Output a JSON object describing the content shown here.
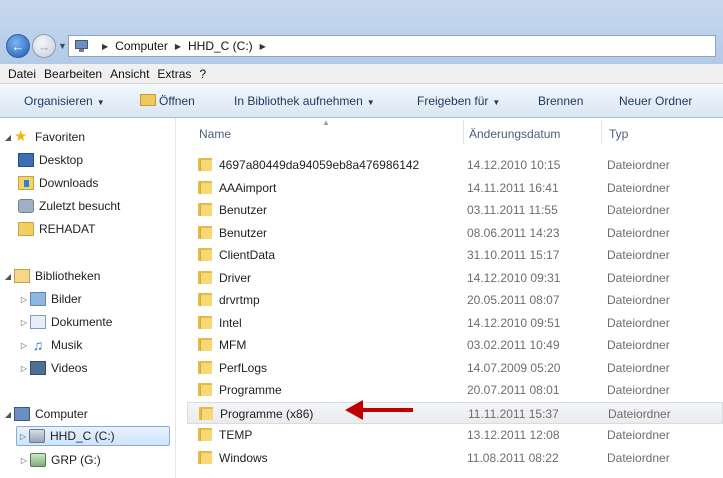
{
  "address": {
    "crumbs": [
      "Computer",
      "HHD_C (C:)"
    ]
  },
  "menu": [
    "Datei",
    "Bearbeiten",
    "Ansicht",
    "Extras",
    "?"
  ],
  "commands": {
    "organize": "Organisieren",
    "open": "Öffnen",
    "library": "In Bibliothek aufnehmen",
    "share": "Freigeben für",
    "burn": "Brennen",
    "new_folder": "Neuer Ordner"
  },
  "nav": {
    "favorites": "Favoriten",
    "desktop": "Desktop",
    "downloads": "Downloads",
    "recent": "Zuletzt besucht",
    "rehadat": "REHADAT",
    "libraries": "Bibliotheken",
    "pictures": "Bilder",
    "documents": "Dokumente",
    "music": "Musik",
    "videos": "Videos",
    "computer": "Computer",
    "drive_c": "HHD_C (C:)",
    "drive_g": "GRP (G:)"
  },
  "columns": {
    "name": "Name",
    "date": "Änderungsdatum",
    "type": "Typ"
  },
  "files": [
    {
      "name": "4697a80449da94059eb8a476986142",
      "date": "14.12.2010 10:15",
      "type": "Dateiordner"
    },
    {
      "name": "AAAimport",
      "date": "14.11.2011 16:41",
      "type": "Dateiordner"
    },
    {
      "name": "Benutzer",
      "date": "03.11.2011 11:55",
      "type": "Dateiordner"
    },
    {
      "name": "Benutzer",
      "date": "08.06.2011 14:23",
      "type": "Dateiordner"
    },
    {
      "name": "ClientData",
      "date": "31.10.2011 15:17",
      "type": "Dateiordner"
    },
    {
      "name": "Driver",
      "date": "14.12.2010 09:31",
      "type": "Dateiordner"
    },
    {
      "name": "drvrtmp",
      "date": "20.05.2011 08:07",
      "type": "Dateiordner"
    },
    {
      "name": "Intel",
      "date": "14.12.2010 09:51",
      "type": "Dateiordner"
    },
    {
      "name": "MFM",
      "date": "03.02.2011 10:49",
      "type": "Dateiordner"
    },
    {
      "name": "PerfLogs",
      "date": "14.07.2009 05:20",
      "type": "Dateiordner"
    },
    {
      "name": "Programme",
      "date": "20.07.2011 08:01",
      "type": "Dateiordner"
    },
    {
      "name": "Programme (x86)",
      "date": "11.11.2011 15:37",
      "type": "Dateiordner"
    },
    {
      "name": "TEMP",
      "date": "13.12.2011 12:08",
      "type": "Dateiordner"
    },
    {
      "name": "Windows",
      "date": "11.08.2011 08:22",
      "type": "Dateiordner"
    }
  ],
  "highlighted_index": 11,
  "colors": {
    "annotation_arrow": "#c00000",
    "selection_border": "#84acdd"
  }
}
